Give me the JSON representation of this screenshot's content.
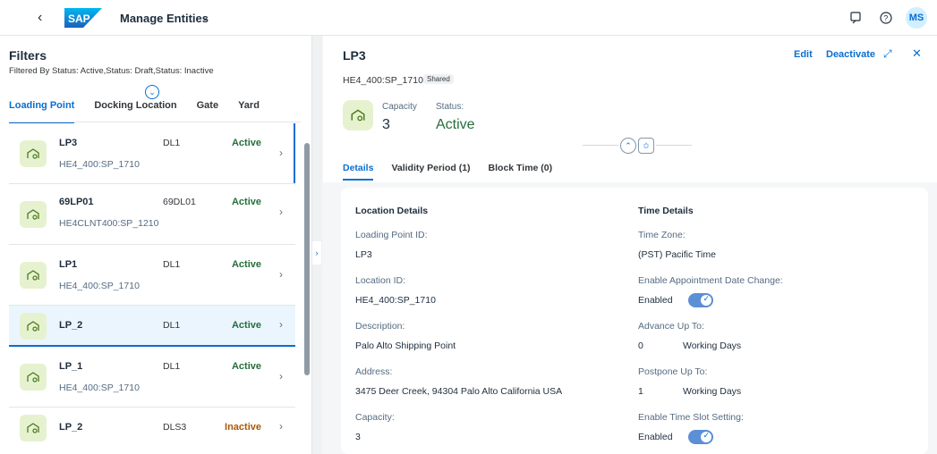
{
  "shell": {
    "logo_text": "SAP",
    "app_title": "Manage Entities",
    "avatar_initials": "MS",
    "icons": [
      "back-icon",
      "notification-icon",
      "help-icon",
      "chevron-down-icon"
    ]
  },
  "filters": {
    "title": "Filters",
    "summary": "Filtered By Status: Active,Status: Draft,Status: Inactive"
  },
  "tabs": [
    {
      "label": "Loading Point",
      "active": true
    },
    {
      "label": "Docking Location",
      "active": false
    },
    {
      "label": "Gate",
      "active": false
    },
    {
      "label": "Yard",
      "active": false
    }
  ],
  "list": [
    {
      "name": "LP3",
      "sub": "HE4_400:SP_1710",
      "dl": "DL1",
      "status": "Active",
      "status_color": "#256f3a"
    },
    {
      "name": "69LP01",
      "sub": "HE4CLNT400:SP_1210",
      "dl": "69DL01",
      "status": "Active",
      "status_color": "#256f3a"
    },
    {
      "name": "LP1",
      "sub": "HE4_400:SP_1710",
      "dl": "DL1",
      "status": "Active",
      "status_color": "#256f3a"
    },
    {
      "name": "LP_2",
      "sub": "",
      "dl": "DL1",
      "status": "Active",
      "status_color": "#256f3a"
    },
    {
      "name": "LP_1",
      "sub": "HE4_400:SP_1710",
      "dl": "DL1",
      "status": "Active",
      "status_color": "#256f3a"
    },
    {
      "name": "LP_2",
      "sub": "",
      "dl": "DLS3",
      "status": "Inactive",
      "status_color": "#aa5808"
    }
  ],
  "detail": {
    "title": "LP3",
    "subtitle": "HE4_400:SP_1710",
    "shared_badge": "Shared",
    "actions": {
      "edit": "Edit",
      "deactivate": "Deactivate"
    },
    "capacity_label": "Capacity",
    "capacity_value": "3",
    "status_label": "Status:",
    "status_value": "Active",
    "tabs": [
      "Details",
      "Validity Period (1)",
      "Block Time (0)"
    ],
    "location": {
      "section": "Location Details",
      "lp_id_label": "Loading Point ID:",
      "lp_id": "LP3",
      "loc_id_label": "Location ID:",
      "loc_id": "HE4_400:SP_1710",
      "desc_label": "Description:",
      "desc": "Palo Alto Shipping Point",
      "addr_label": "Address:",
      "addr": "3475 Deer Creek, 94304 Palo Alto California USA",
      "cap_label": "Capacity:",
      "cap": "3"
    },
    "time": {
      "section": "Time Details",
      "tz_label": "Time Zone:",
      "tz": "(PST) Pacific Time",
      "appt_label": "Enable Appointment Date Change:",
      "appt": "Enabled",
      "adv_label": "Advance Up To:",
      "adv_num": "0",
      "adv_unit": "Working Days",
      "post_label": "Postpone Up To:",
      "post_num": "1",
      "post_unit": "Working Days",
      "slot_label": "Enable Time Slot Setting:",
      "slot": "Enabled"
    }
  }
}
